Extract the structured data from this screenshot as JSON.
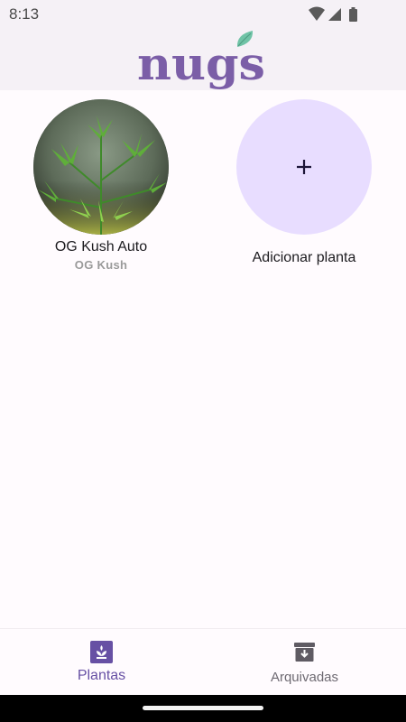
{
  "status_bar": {
    "time": "8:13",
    "icons": [
      "wifi-icon",
      "signal-icon",
      "battery-icon"
    ]
  },
  "app_bar": {
    "logo_text": "nugs"
  },
  "plants": [
    {
      "name": "OG Kush Auto",
      "strain": "OG Kush"
    }
  ],
  "add_plant": {
    "label": "Adicionar planta",
    "icon": "plus-icon"
  },
  "bottom_nav": {
    "items": [
      {
        "label": "Plantas",
        "icon": "plant-icon",
        "active": true
      },
      {
        "label": "Arquivadas",
        "icon": "archive-icon",
        "active": false
      }
    ]
  },
  "colors": {
    "accent": "#6750a4",
    "logo": "#7b5ea7",
    "add_circle": "#e8ddff",
    "leaf": "#6fc3a6"
  }
}
